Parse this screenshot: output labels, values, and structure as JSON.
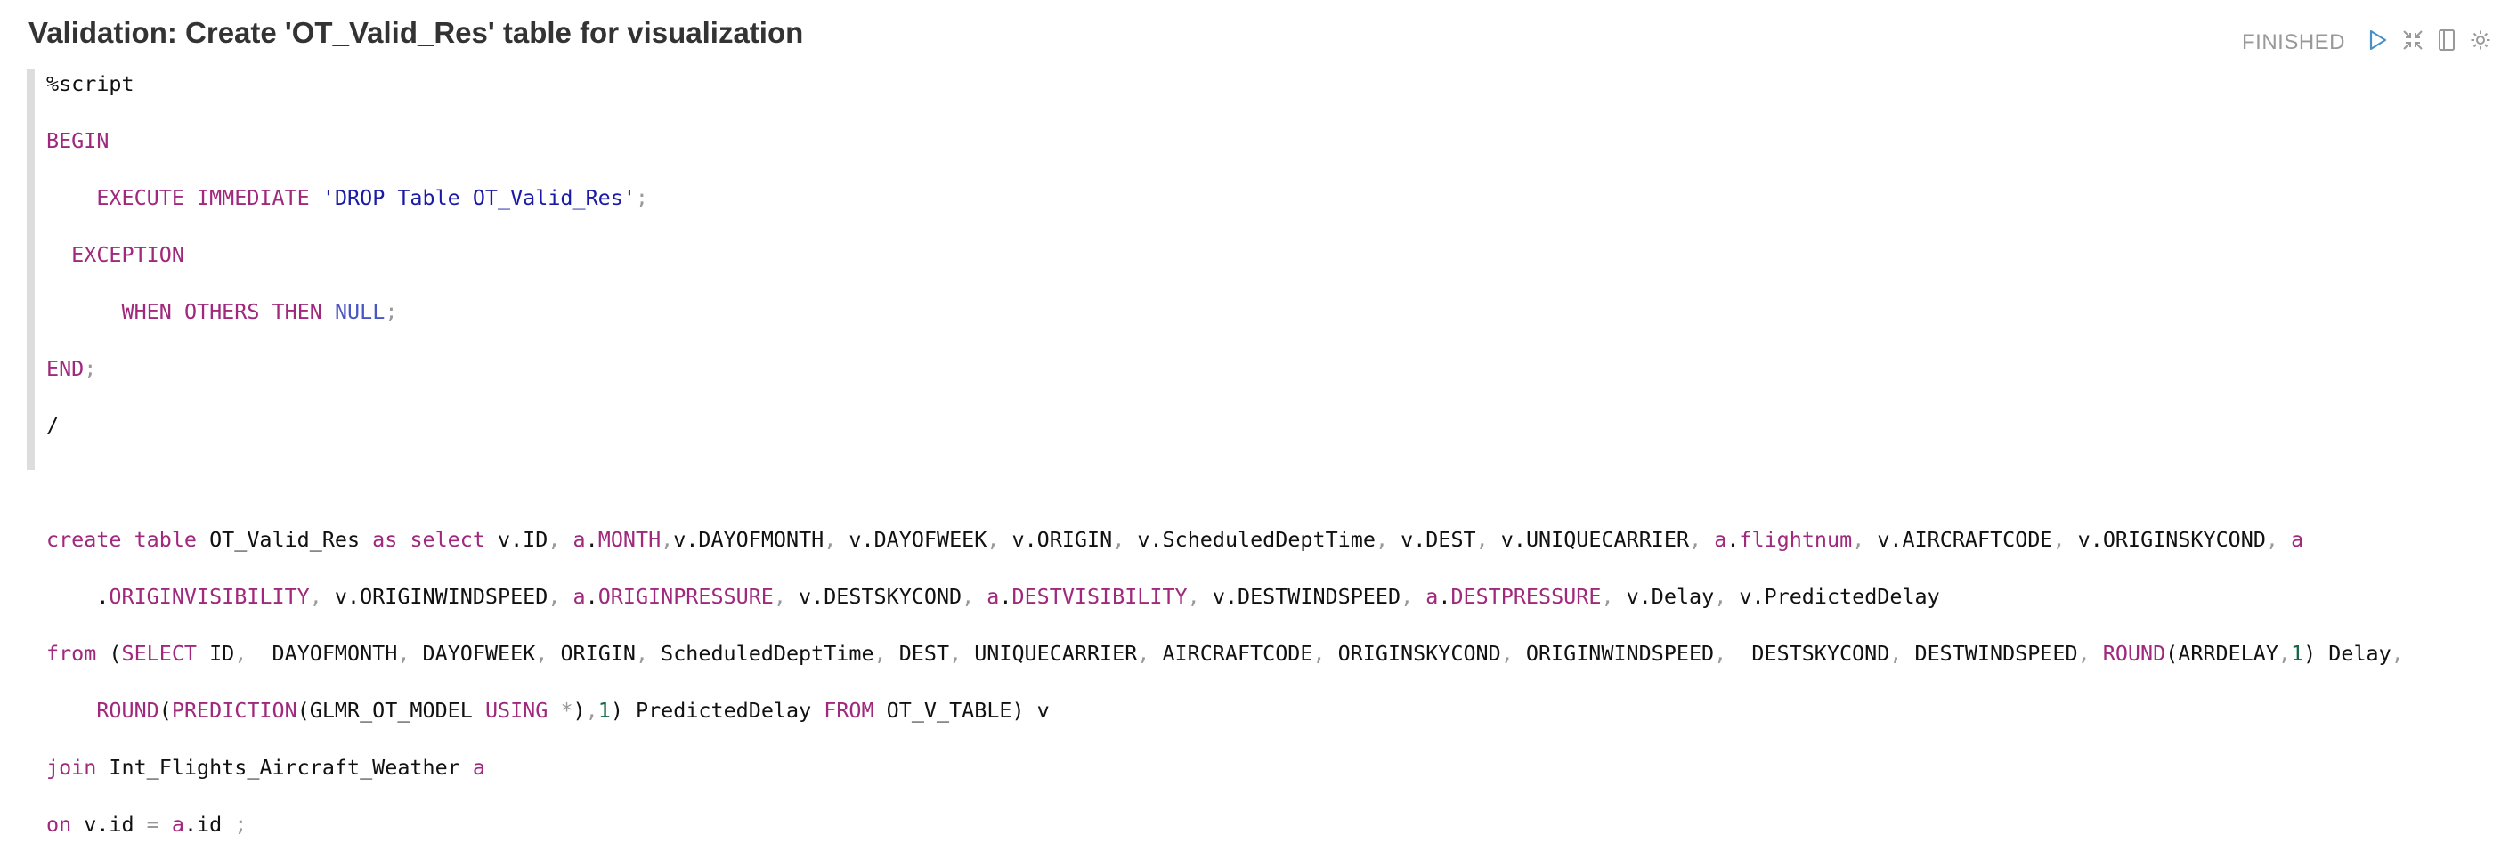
{
  "paragraph": {
    "title": "Validation: Create 'OT_Valid_Res' table for visualization",
    "status": "FINISHED"
  },
  "icons": {
    "run": "play-icon",
    "hide_editor": "collapse-arrows-icon",
    "toggle_output": "book-icon",
    "settings": "gear-icon"
  },
  "colors": {
    "keyword": "#a0287d",
    "string": "#1a1aa6",
    "number": "#116644",
    "null": "#4a55c4",
    "gutter": "#dddddd",
    "status": "#999999"
  },
  "code": {
    "lines": [
      "%script",
      "BEGIN",
      "    EXECUTE IMMEDIATE 'DROP Table OT_Valid_Res';",
      "  EXCEPTION",
      "      WHEN OTHERS THEN NULL;",
      "END;",
      "/",
      "",
      "create table OT_Valid_Res as select v.ID, a.MONTH,v.DAYOFMONTH, v.DAYOFWEEK, v.ORIGIN, v.ScheduledDeptTime, v.DEST, v.UNIQUECARRIER, a.flightnum, v.AIRCRAFTCODE, v.ORIGINSKYCOND, a",
      "    .ORIGINVISIBILITY, v.ORIGINWINDSPEED, a.ORIGINPRESSURE, v.DESTSKYCOND, a.DESTVISIBILITY, v.DESTWINDSPEED, a.DESTPRESSURE, v.Delay, v.PredictedDelay",
      "from (SELECT ID,  DAYOFMONTH, DAYOFWEEK, ORIGIN, ScheduledDeptTime, DEST, UNIQUECARRIER, AIRCRAFTCODE, ORIGINSKYCOND, ORIGINWINDSPEED,  DESTSKYCOND, DESTWINDSPEED, ROUND(ARRDELAY,1) Delay,",
      "    ROUND(PREDICTION(GLMR_OT_MODEL USING *),1) PredictedDelay FROM OT_V_TABLE) v",
      "join Int_Flights_Aircraft_Weather a",
      "on v.id = a.id ;"
    ]
  }
}
